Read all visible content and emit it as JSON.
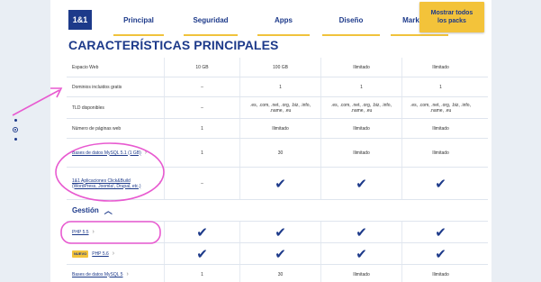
{
  "nav": {
    "logo": "1&1",
    "items": [
      "Principal",
      "Seguridad",
      "Apps",
      "Diseño",
      "Marketing"
    ],
    "cta_line1": "Mostrar todos",
    "cta_line2": "los packs"
  },
  "title": "CARACTERÍSTICAS PRINCIPALES",
  "rows": [
    {
      "label": "Espacio Web",
      "v": [
        "10 GB",
        "100 GB",
        "Ilimitado",
        "Ilimitado"
      ]
    },
    {
      "label": "Dominios incluidos gratis",
      "v": [
        "–",
        "1",
        "1",
        "1"
      ]
    },
    {
      "label": "TLD disponibles",
      "v": [
        "–",
        ".es, .com, .net, .org, .biz, .info, .name, .eu",
        ".es, .com, .net, .org, .biz, .info, .name, .eu",
        ".es, .com, .net, .org, .biz, .info, .name, .eu"
      ]
    },
    {
      "label": "Número de páginas web",
      "v": [
        "1",
        "Ilimitado",
        "Ilimitado",
        "Ilimitado"
      ]
    },
    {
      "label": "Bases de datos MySQL 5.1 (1 GB)",
      "v": [
        "1",
        "30",
        "Ilimitado",
        "Ilimitado"
      ]
    },
    {
      "label": "1&1 Aplicaciones Click&Build (WordPress, Joomla!, Drupal, etc.)",
      "v": [
        "–",
        "✔",
        "✔",
        "✔"
      ]
    }
  ],
  "section": {
    "label": "Gestión",
    "caret": "︿"
  },
  "rows2": [
    {
      "label": "PHP 5.5",
      "badge": "",
      "v": [
        "✔",
        "✔",
        "✔",
        "✔"
      ]
    },
    {
      "label": "PHP 5.6",
      "badge": "NUEVO",
      "v": [
        "✔",
        "✔",
        "✔",
        "✔"
      ]
    },
    {
      "label": "Bases de datos MySQL 5",
      "badge": "",
      "v": [
        "1",
        "30",
        "Ilimitado",
        "Ilimitado"
      ]
    }
  ],
  "colors": {
    "brand": "#1d3a8a",
    "accent": "#f3c33a",
    "annotation": "#e85ad0"
  }
}
